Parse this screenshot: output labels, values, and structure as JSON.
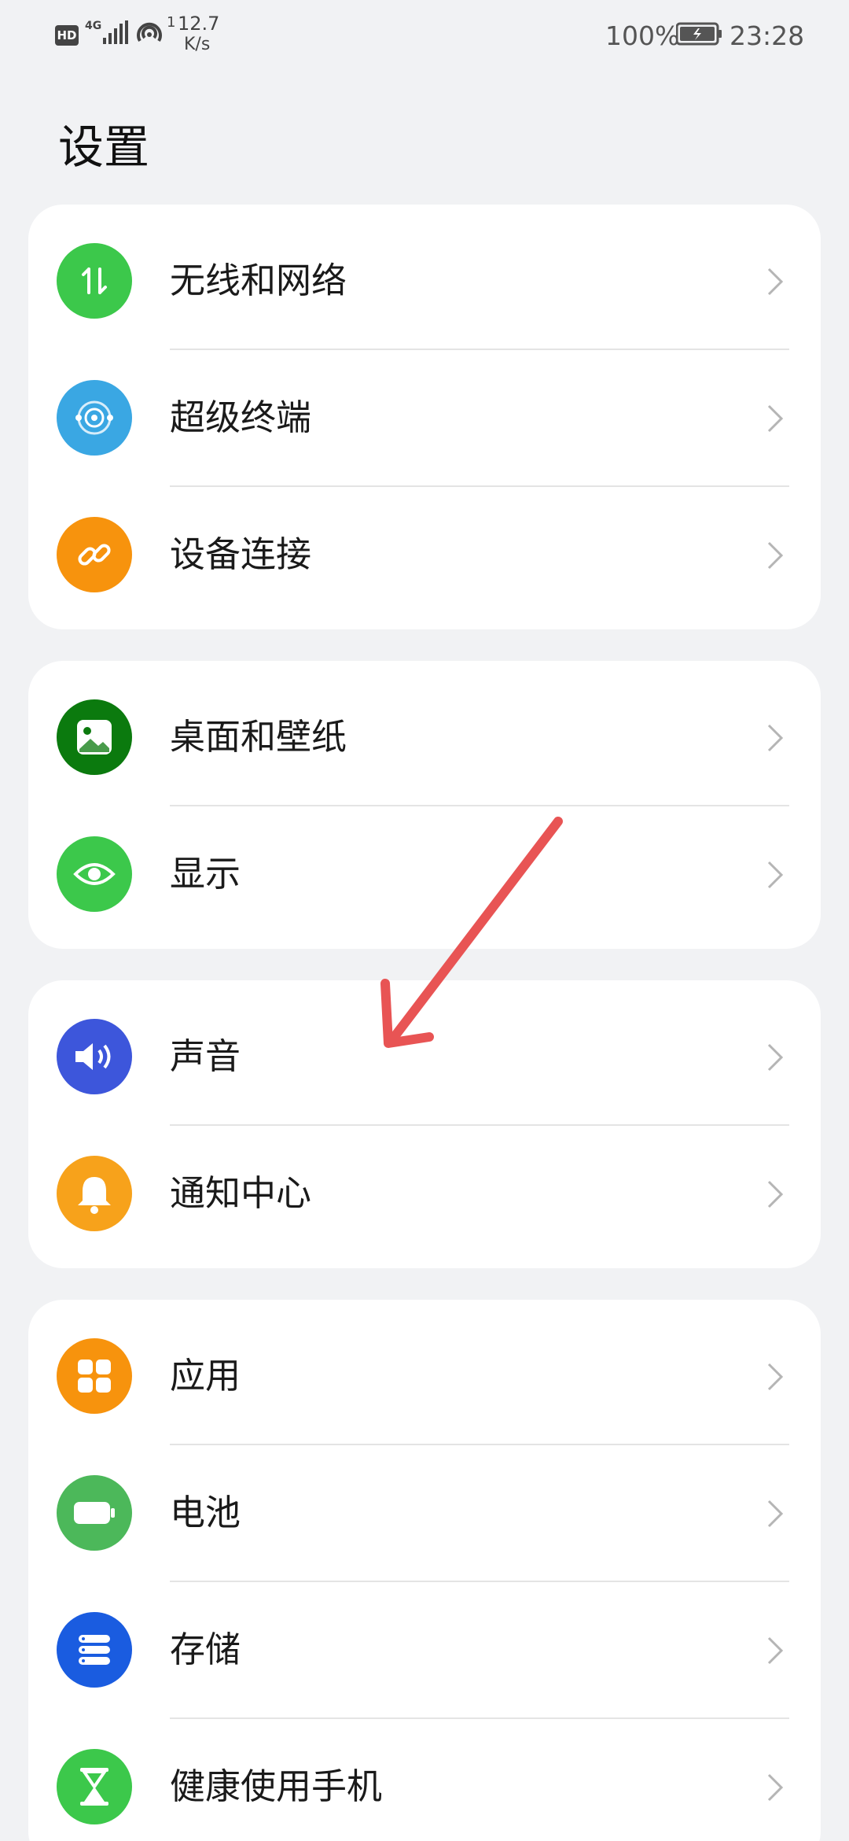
{
  "status_bar": {
    "hd": "HD",
    "network": "4G",
    "speed_sup": "1",
    "speed_value": "12.7",
    "speed_unit": "K/s",
    "battery_percent": "100%",
    "time": "23:28"
  },
  "page": {
    "title": "设置"
  },
  "groups": [
    {
      "items": [
        {
          "label": "无线和网络",
          "icon": "wireless-network-icon",
          "color": "#3cc84b"
        },
        {
          "label": "超级终端",
          "icon": "super-device-icon",
          "color": "#3aa7e3"
        },
        {
          "label": "设备连接",
          "icon": "link-icon",
          "color": "#f7930d"
        }
      ]
    },
    {
      "items": [
        {
          "label": "桌面和壁纸",
          "icon": "wallpaper-icon",
          "color": "#0b7a0e"
        },
        {
          "label": "显示",
          "icon": "eye-icon",
          "color": "#3cc84b"
        }
      ]
    },
    {
      "items": [
        {
          "label": "声音",
          "icon": "speaker-icon",
          "color": "#3d56db"
        },
        {
          "label": "通知中心",
          "icon": "bell-icon",
          "color": "#f7a21b"
        }
      ]
    },
    {
      "items": [
        {
          "label": "应用",
          "icon": "apps-icon",
          "color": "#f7930d"
        },
        {
          "label": "电池",
          "icon": "battery-icon",
          "color": "#4cb85a"
        },
        {
          "label": "存储",
          "icon": "storage-icon",
          "color": "#1a5ce0"
        },
        {
          "label": "健康使用手机",
          "icon": "hourglass-icon",
          "color": "#3cc84b"
        }
      ]
    }
  ],
  "colors": {
    "background": "#f1f2f4",
    "card": "#ffffff",
    "annotation_arrow": "#e85454"
  }
}
